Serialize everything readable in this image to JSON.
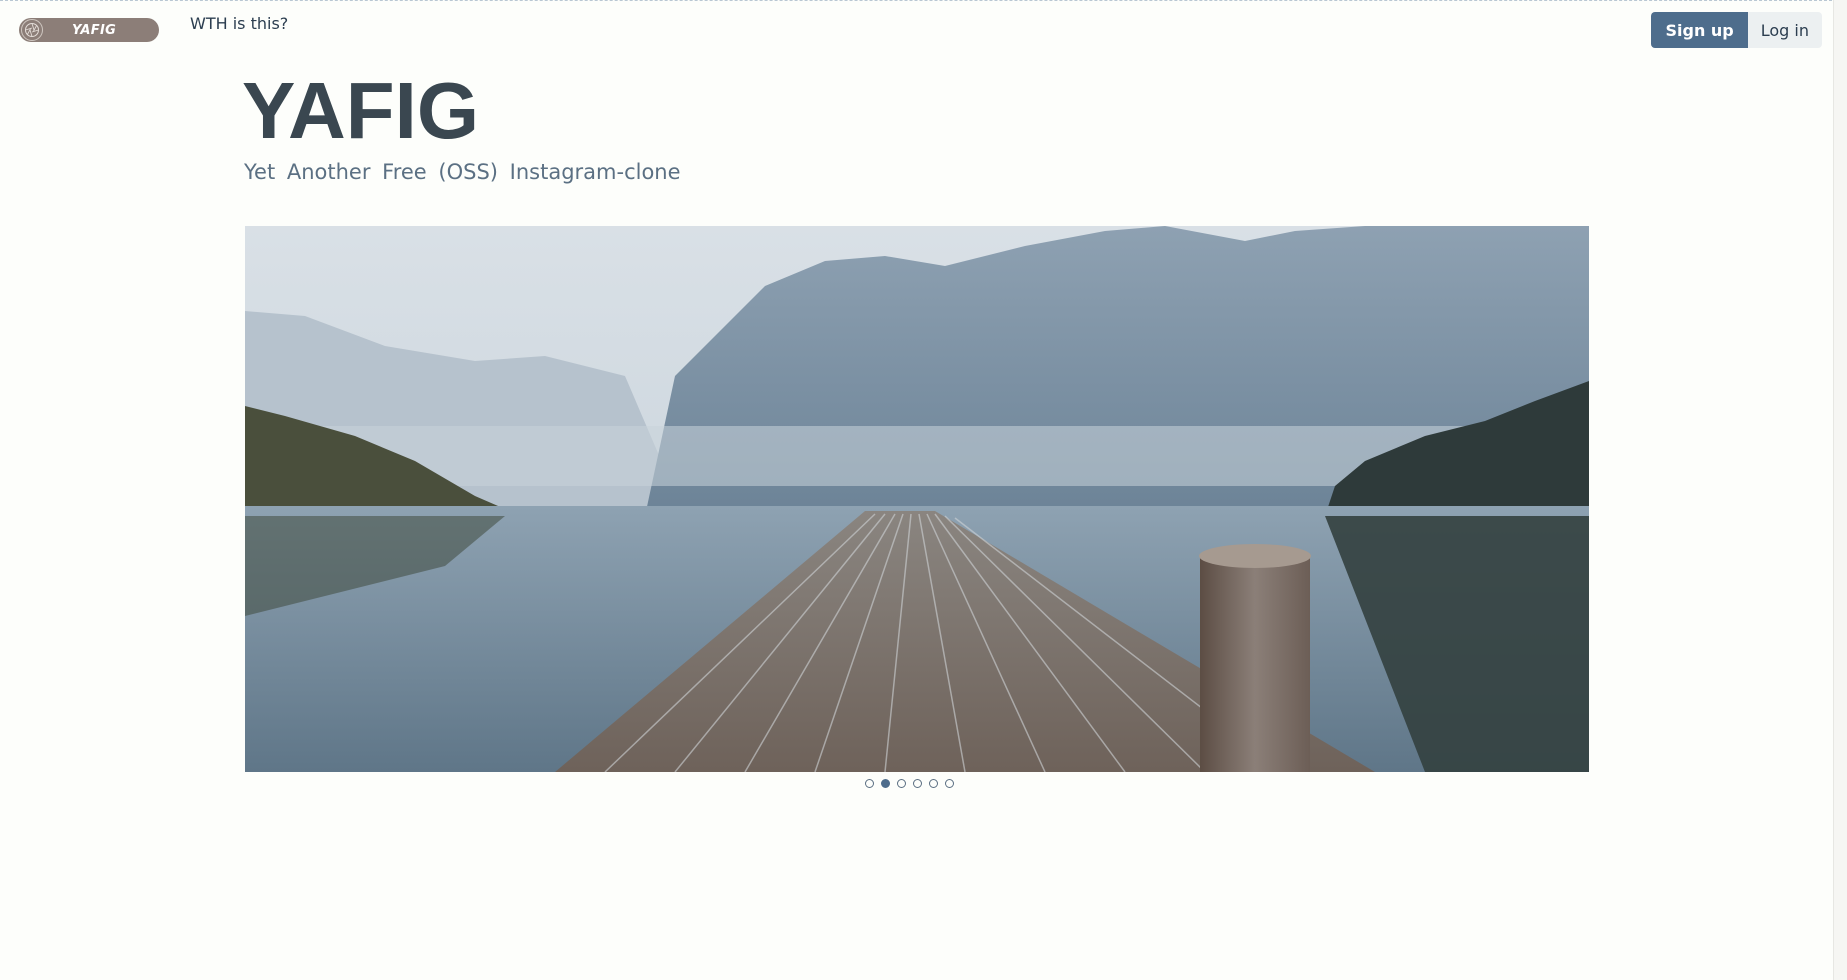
{
  "header": {
    "logo_text": "YAFIG",
    "nav_link": "WTH is this?",
    "signup_label": "Sign up",
    "login_label": "Log in"
  },
  "hero": {
    "title": "YAFIG",
    "subtitle": "Yet Another Free (OSS) Instagram-clone"
  },
  "carousel": {
    "slide_count": 6,
    "active_index": 1,
    "image_subject": "lake-with-mountains-and-wooden-pier"
  },
  "icons": {
    "logo": "camera-aperture-icon"
  },
  "colors": {
    "primary": "#4e6d8c",
    "logo_bg": "#8c7e78",
    "secondary_btn": "#ecf0f1",
    "page_bg": "#fdfefb"
  }
}
